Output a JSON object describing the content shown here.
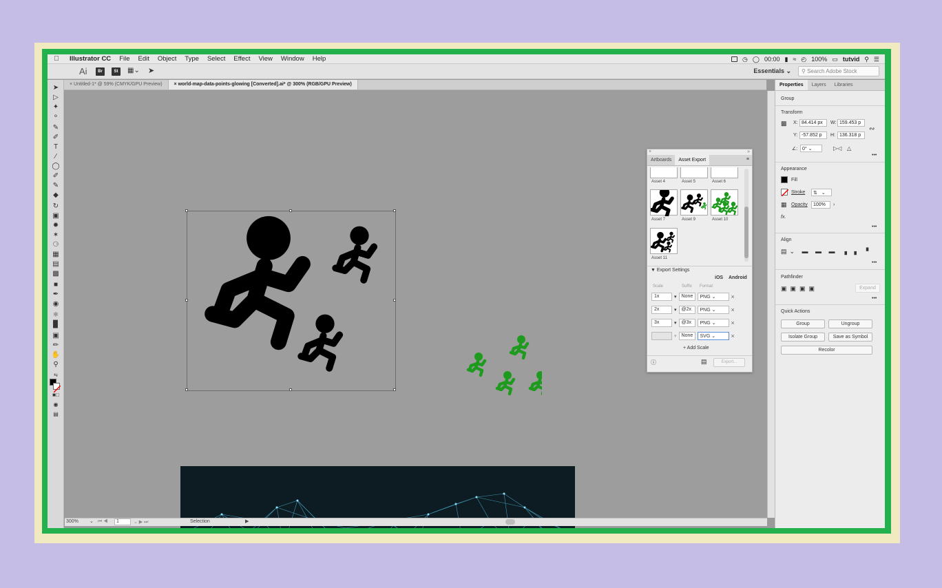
{
  "menubar": {
    "app_name": "Illustrator CC",
    "items": [
      "File",
      "Edit",
      "Object",
      "Type",
      "Select",
      "Effect",
      "View",
      "Window",
      "Help"
    ],
    "clock": "00:00",
    "battery": "100%",
    "user": "tutvid"
  },
  "control_bar": {
    "logo": "Ai",
    "br": "Br",
    "st": "St",
    "workspace": "Essentials",
    "search_placeholder": "Search Adobe Stock"
  },
  "doc_tabs": [
    "Untitled-1* @ 59% (CMYK/GPU Preview)",
    "world-map-data-points-glowing [Converted].ai* @ 300% (RGB/GPU Preview)"
  ],
  "status_bar": {
    "zoom": "300%",
    "artboard": "1",
    "tool": "Selection"
  },
  "asset_panel": {
    "tabs": [
      "Artboards",
      "Asset Export"
    ],
    "assets": [
      "Asset 4",
      "Asset 5",
      "Asset 6",
      "Asset 7",
      "Asset 9",
      "Asset 10",
      "Asset 11"
    ],
    "export_settings_label": "Export Settings",
    "platforms": [
      "iOS",
      "Android"
    ],
    "columns": [
      "Scale",
      "Suffix",
      "Format"
    ],
    "rows": [
      {
        "scale": "1x",
        "suffix": "None",
        "format": "PNG"
      },
      {
        "scale": "2x",
        "suffix": "@2x",
        "format": "PNG"
      },
      {
        "scale": "3x",
        "suffix": "@3x",
        "format": "PNG"
      },
      {
        "scale": "",
        "suffix": "None",
        "format": "SVG"
      }
    ],
    "add_scale": "+ Add Scale",
    "export_button": "Export..."
  },
  "properties": {
    "tabs": [
      "Properties",
      "Layers",
      "Libraries"
    ],
    "selection_type": "Group",
    "transform_label": "Transform",
    "x": "84.414 px",
    "y": "-57.852 p",
    "w": "159.453 p",
    "h": "136.318 p",
    "angle": "0°",
    "appearance_label": "Appearance",
    "fill": "Fill",
    "stroke": "Stroke",
    "opacity_label": "Opacity",
    "opacity": "100%",
    "fx": "fx.",
    "align_label": "Align",
    "pathfinder_label": "Pathfinder",
    "expand": "Expand",
    "quick_actions_label": "Quick Actions",
    "buttons": {
      "group": "Group",
      "ungroup": "Ungroup",
      "isolate": "Isolate Group",
      "save_symbol": "Save as Symbol",
      "recolor": "Recolor"
    }
  },
  "colors": {
    "frame_green": "#22b14c",
    "figure_green": "#1e9b1e",
    "figure_black": "#000000",
    "background_lavender": "#c5bde6"
  }
}
